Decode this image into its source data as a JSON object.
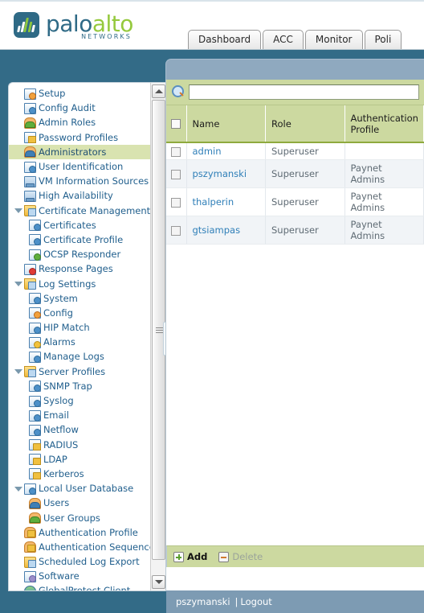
{
  "brand": {
    "name_part1": "palo",
    "name_part2": "alto",
    "tagline": "NETWORKS",
    "logo_bg": "#2f6a86",
    "accent_green": "#95c93d"
  },
  "tabs": [
    {
      "label": "Dashboard"
    },
    {
      "label": "ACC"
    },
    {
      "label": "Monitor"
    },
    {
      "label": "Poli"
    }
  ],
  "sidebar": {
    "items": [
      {
        "label": "Setup",
        "level": 1,
        "icon": "setup-icon",
        "twisty": false,
        "selected": false
      },
      {
        "label": "Config Audit",
        "level": 1,
        "icon": "config-audit-icon",
        "twisty": false,
        "selected": false
      },
      {
        "label": "Admin Roles",
        "level": 1,
        "icon": "admin-roles-icon",
        "twisty": false,
        "selected": false
      },
      {
        "label": "Password Profiles",
        "level": 1,
        "icon": "password-profiles-icon",
        "twisty": false,
        "selected": false
      },
      {
        "label": "Administrators",
        "level": 1,
        "icon": "administrators-icon",
        "twisty": false,
        "selected": true
      },
      {
        "label": "User Identification",
        "level": 1,
        "icon": "user-identification-icon",
        "twisty": false,
        "selected": false
      },
      {
        "label": "VM Information Sources",
        "level": 1,
        "icon": "vm-information-sources-icon",
        "twisty": false,
        "selected": false
      },
      {
        "label": "High Availability",
        "level": 1,
        "icon": "high-availability-icon",
        "twisty": false,
        "selected": false
      },
      {
        "label": "Certificate Management",
        "level": 1,
        "icon": "certificate-management-folder-icon",
        "twisty": true,
        "selected": false
      },
      {
        "label": "Certificates",
        "level": 2,
        "icon": "certificates-icon",
        "twisty": false,
        "selected": false
      },
      {
        "label": "Certificate Profile",
        "level": 2,
        "icon": "certificate-profile-icon",
        "twisty": false,
        "selected": false
      },
      {
        "label": "OCSP Responder",
        "level": 2,
        "icon": "ocsp-responder-icon",
        "twisty": false,
        "selected": false
      },
      {
        "label": "Response Pages",
        "level": 1,
        "icon": "response-pages-icon",
        "twisty": false,
        "selected": false
      },
      {
        "label": "Log Settings",
        "level": 1,
        "icon": "log-settings-folder-icon",
        "twisty": true,
        "selected": false
      },
      {
        "label": "System",
        "level": 2,
        "icon": "system-log-icon",
        "twisty": false,
        "selected": false
      },
      {
        "label": "Config",
        "level": 2,
        "icon": "config-log-icon",
        "twisty": false,
        "selected": false
      },
      {
        "label": "HIP Match",
        "level": 2,
        "icon": "hip-match-log-icon",
        "twisty": false,
        "selected": false
      },
      {
        "label": "Alarms",
        "level": 2,
        "icon": "alarms-icon",
        "twisty": false,
        "selected": false
      },
      {
        "label": "Manage Logs",
        "level": 2,
        "icon": "manage-logs-icon",
        "twisty": false,
        "selected": false
      },
      {
        "label": "Server Profiles",
        "level": 1,
        "icon": "server-profiles-folder-icon",
        "twisty": true,
        "selected": false
      },
      {
        "label": "SNMP Trap",
        "level": 2,
        "icon": "snmp-trap-icon",
        "twisty": false,
        "selected": false
      },
      {
        "label": "Syslog",
        "level": 2,
        "icon": "syslog-icon",
        "twisty": false,
        "selected": false
      },
      {
        "label": "Email",
        "level": 2,
        "icon": "email-icon",
        "twisty": false,
        "selected": false
      },
      {
        "label": "Netflow",
        "level": 2,
        "icon": "netflow-icon",
        "twisty": false,
        "selected": false
      },
      {
        "label": "RADIUS",
        "level": 2,
        "icon": "radius-icon",
        "twisty": false,
        "selected": false
      },
      {
        "label": "LDAP",
        "level": 2,
        "icon": "ldap-icon",
        "twisty": false,
        "selected": false
      },
      {
        "label": "Kerberos",
        "level": 2,
        "icon": "kerberos-icon",
        "twisty": false,
        "selected": false
      },
      {
        "label": "Local User Database",
        "level": 1,
        "icon": "local-user-database-icon",
        "twisty": true,
        "selected": false
      },
      {
        "label": "Users",
        "level": 2,
        "icon": "users-icon",
        "twisty": false,
        "selected": false
      },
      {
        "label": "User Groups",
        "level": 2,
        "icon": "user-groups-icon",
        "twisty": false,
        "selected": false
      },
      {
        "label": "Authentication Profile",
        "level": 1,
        "icon": "authentication-profile-icon",
        "twisty": false,
        "selected": false
      },
      {
        "label": "Authentication Sequence",
        "level": 1,
        "icon": "authentication-sequence-icon",
        "twisty": false,
        "selected": false
      },
      {
        "label": "Scheduled Log Export",
        "level": 1,
        "icon": "scheduled-log-export-icon",
        "twisty": false,
        "selected": false
      },
      {
        "label": "Software",
        "level": 1,
        "icon": "software-icon",
        "twisty": false,
        "selected": false
      },
      {
        "label": "GlobalProtect Client",
        "level": 1,
        "icon": "globalprotect-client-icon",
        "twisty": false,
        "selected": false
      }
    ]
  },
  "search": {
    "value": "",
    "placeholder": ""
  },
  "table": {
    "columns": [
      "Name",
      "Role",
      "Authentication Profile"
    ],
    "rows": [
      {
        "name": "admin",
        "role": "Superuser",
        "auth_profile": ""
      },
      {
        "name": "pszymanski",
        "role": "Superuser",
        "auth_profile": "Paynet Admins"
      },
      {
        "name": "thalperin",
        "role": "Superuser",
        "auth_profile": "Paynet Admins"
      },
      {
        "name": "gtsiampas",
        "role": "Superuser",
        "auth_profile": "Paynet Admins"
      }
    ]
  },
  "actions": {
    "add_label": "Add",
    "delete_label": "Delete"
  },
  "footer": {
    "user": "pszymanski",
    "separator": "|",
    "logout_label": "Logout"
  }
}
